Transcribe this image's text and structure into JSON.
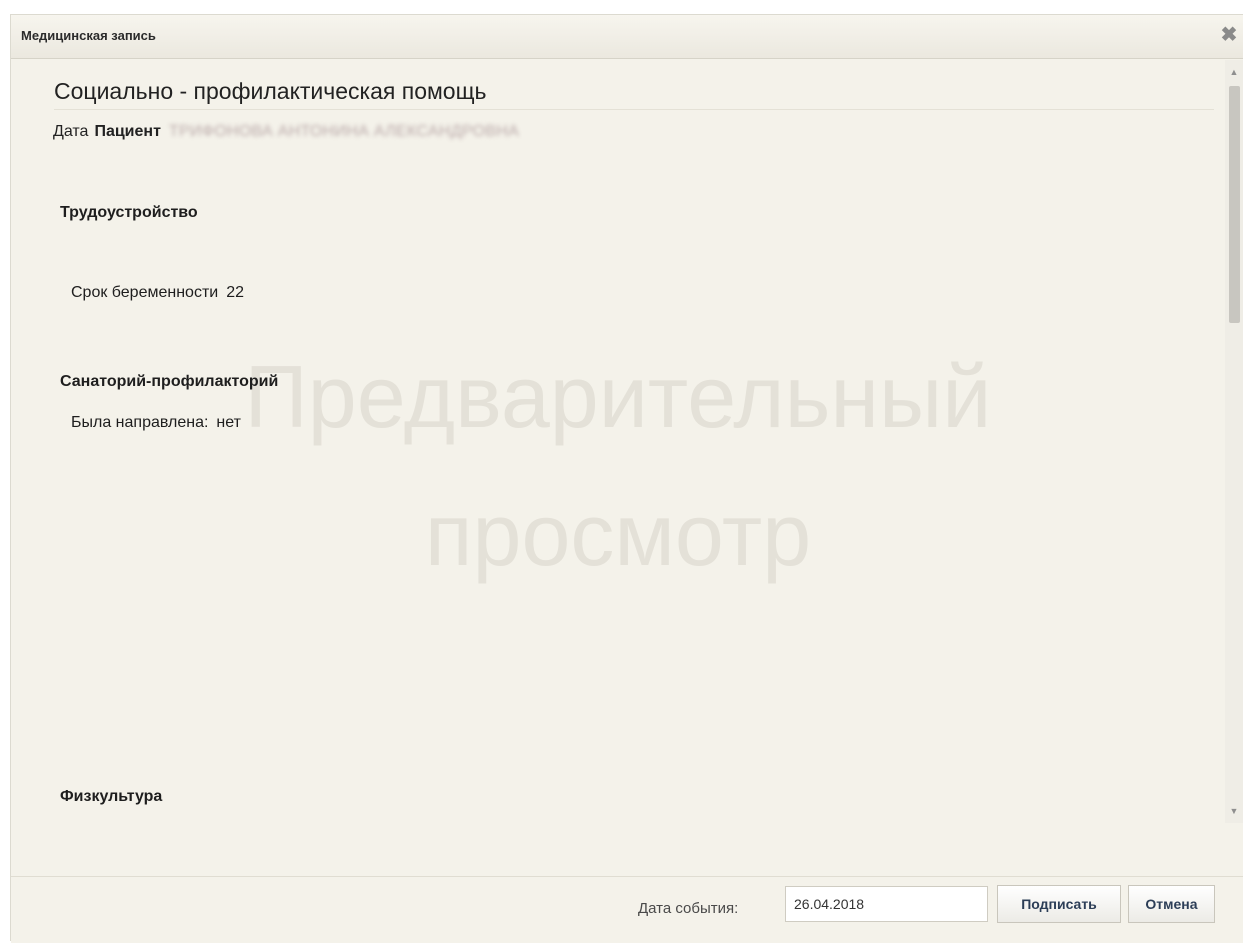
{
  "window": {
    "title": "Медицинская запись",
    "close_icon": "close-icon"
  },
  "record": {
    "title": "Социально - профилактическая помощь",
    "date_label": "Дата",
    "patient_label": "Пациент",
    "patient_name": "ТРИФОНОВА АНТОНИНА АЛЕКСАНДРОВНА"
  },
  "watermark": {
    "line1": "Предварительный",
    "line2": "просмотр"
  },
  "sections": {
    "employment": {
      "heading": "Трудоустройство",
      "field_label": "Срок беременности",
      "field_value": "22"
    },
    "sanatorium": {
      "heading": "Санаторий-профилакторий",
      "field_label": "Была направлена:",
      "field_value": "нет"
    },
    "physical": {
      "heading": "Физкультура"
    }
  },
  "footer": {
    "event_date_label": "Дата события:",
    "event_date_value": "26.04.2018",
    "sign_label": "Подписать",
    "cancel_label": "Отмена"
  }
}
